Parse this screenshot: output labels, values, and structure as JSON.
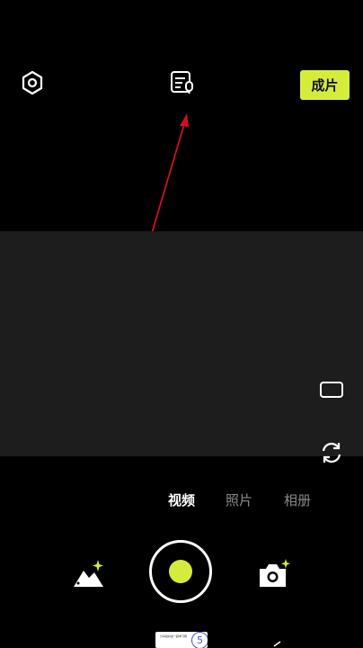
{
  "topbar": {
    "settings_icon": "hexagon-settings-icon",
    "script_icon": "teleprompter-script-icon",
    "finish_label": "成片",
    "accent": "#d6ec3b"
  },
  "annotation": {
    "arrow_color": "#d01020"
  },
  "side_controls": {
    "ratio_icon": "aspect-ratio-icon",
    "flip_icon": "flip-camera-icon"
  },
  "modes": [
    {
      "label": "视频",
      "active": true
    },
    {
      "label": "照片",
      "active": false
    },
    {
      "label": "相册",
      "active": false
    }
  ],
  "bottom": {
    "gallery_icon": "gallery-sparkle-icon",
    "shutter_color": "#d6ec3b",
    "camera_icon": "camera-sparkle-icon",
    "thumbnail": {
      "text": "分享给好友一起学习吧",
      "badge": "5"
    }
  }
}
